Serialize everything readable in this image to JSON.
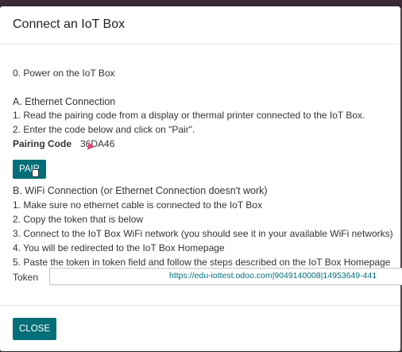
{
  "modal": {
    "title": "Connect an IoT Box",
    "step0": "0. Power on the IoT Box",
    "ethernet": {
      "heading": "A. Ethernet Connection",
      "step1": "1. Read the pairing code from a display or thermal printer connected to the IoT Box.",
      "step2": "2. Enter the code below and click on \"Pair\".",
      "pairing_label": "Pairing Code",
      "pairing_value": "36DA46",
      "pair_button": "PAIR"
    },
    "wifi": {
      "heading": "B. WiFi Connection (or Ethernet Connection doesn't work)",
      "steps": [
        "1. Make sure no ethernet cable is connected to the IoT Box",
        "2. Copy the token that is below",
        "3. Connect to the IoT Box WiFi network (you should see it in your available WiFi networks)",
        "4. You will be redirected to the IoT Box Homepage",
        "5. Paste the token in token field and follow the steps described on the IoT Box Homepage"
      ],
      "token_label": "Token",
      "token_value": "https://edu-iottest.odoo.com|9049140008|14953649-441"
    },
    "close_button": "CLOSE"
  },
  "colors": {
    "primary": "#016e78",
    "backdrop": "#5a4e55"
  }
}
